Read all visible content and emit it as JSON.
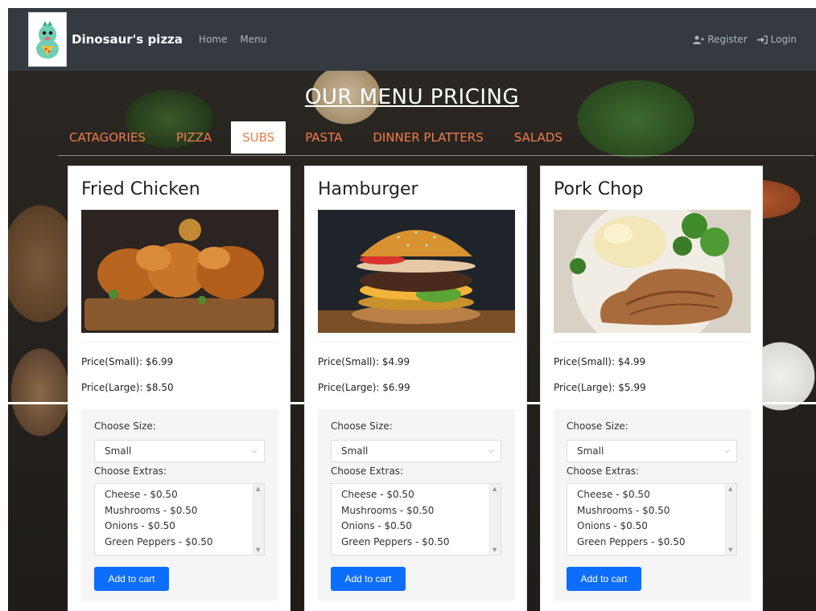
{
  "navbar": {
    "brand": "Dinosaur's pizza",
    "links": [
      "Home",
      "Menu"
    ],
    "right_links": [
      {
        "label": "Register",
        "icon": "user-plus-icon"
      },
      {
        "label": "Login",
        "icon": "sign-in-icon"
      }
    ]
  },
  "menu": {
    "title": "OUR MENU PRICING",
    "categories": [
      "CATAGORIES",
      "PIZZA",
      "SUBS",
      "PASTA",
      "DINNER PLATTERS",
      "SALADS"
    ],
    "active_category": "SUBS"
  },
  "cards": [
    {
      "title": "Fried Chicken",
      "price_small": "Price(Small): $6.99",
      "price_large": "Price(Large): $8.50",
      "size_label": "Choose Size:",
      "size_value": "Small",
      "extras_label": "Choose Extras:",
      "extras": [
        "Cheese - $0.50",
        "Mushrooms - $0.50",
        "Onions - $0.50",
        "Green Peppers - $0.50"
      ],
      "button": "Add to cart"
    },
    {
      "title": "Hamburger",
      "price_small": "Price(Small): $4.99",
      "price_large": "Price(Large): $6.99",
      "size_label": "Choose Size:",
      "size_value": "Small",
      "extras_label": "Choose Extras:",
      "extras": [
        "Cheese - $0.50",
        "Mushrooms - $0.50",
        "Onions - $0.50",
        "Green Peppers - $0.50"
      ],
      "button": "Add to cart"
    },
    {
      "title": "Pork Chop",
      "price_small": "Price(Small): $4.99",
      "price_large": "Price(Large): $5.99",
      "size_label": "Choose Size:",
      "size_value": "Small",
      "extras_label": "Choose Extras:",
      "extras": [
        "Cheese - $0.50",
        "Mushrooms - $0.50",
        "Onions - $0.50",
        "Green Peppers - $0.50"
      ],
      "button": "Add to cart"
    }
  ],
  "colors": {
    "navbar": "#343a40",
    "category_text": "#f07b4a",
    "button": "#0d6efd"
  }
}
